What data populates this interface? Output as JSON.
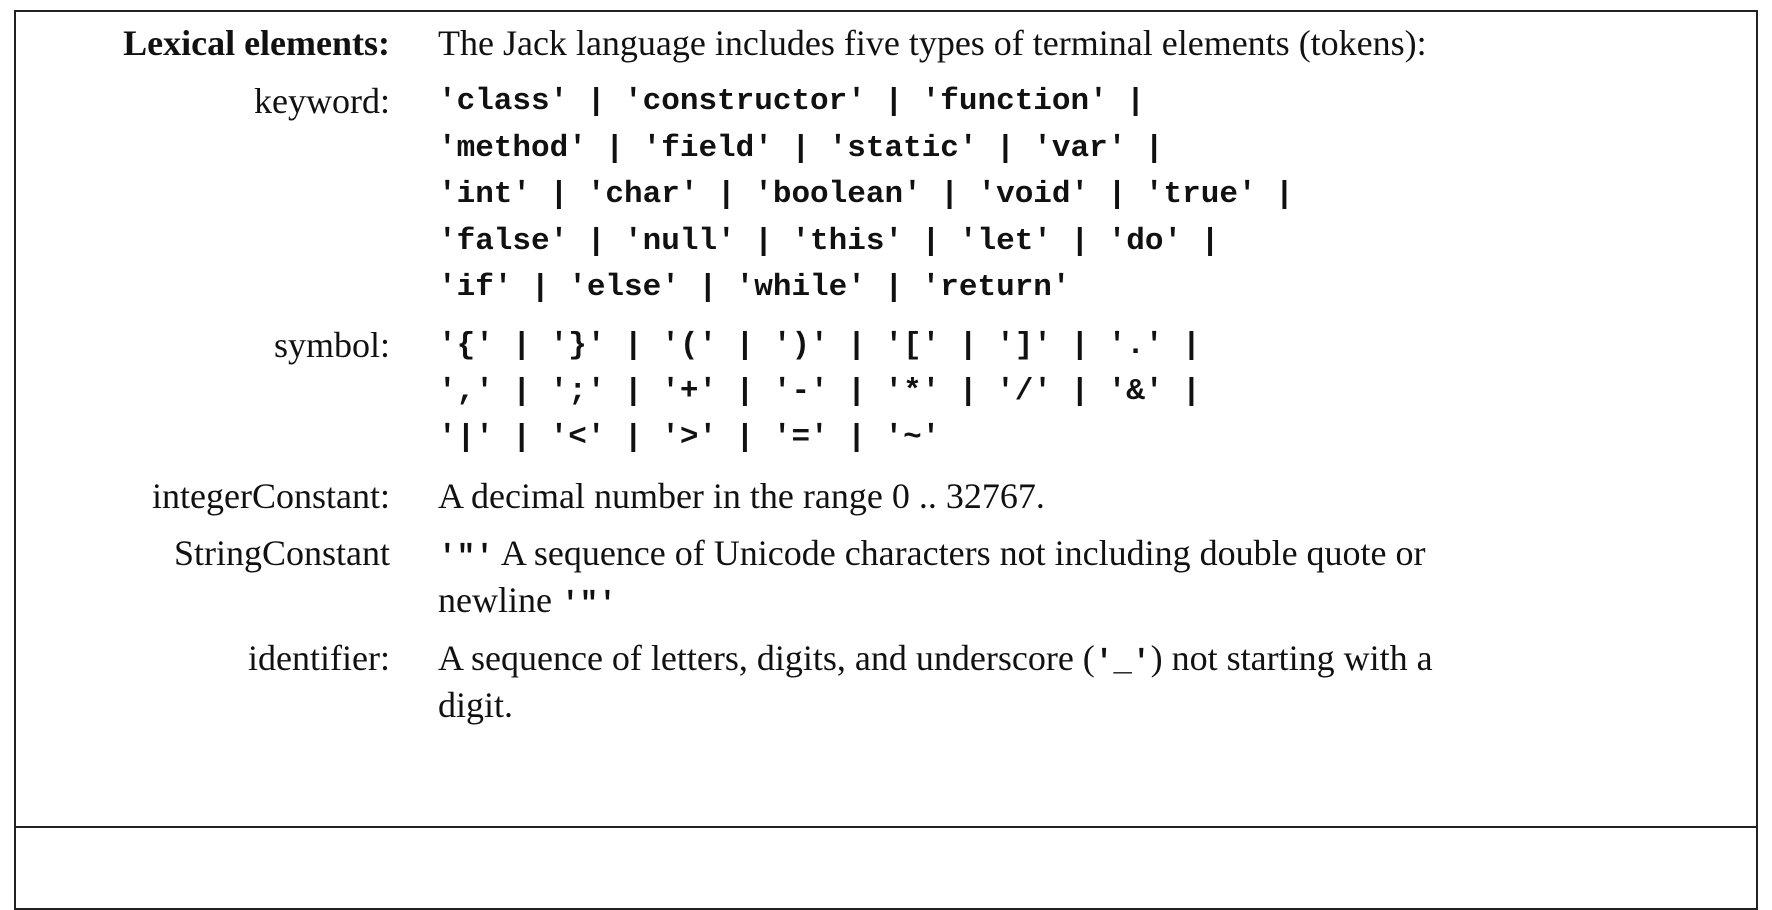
{
  "lexical": {
    "heading_label": "Lexical elements:",
    "heading_text": "The Jack language includes five types of terminal elements (tokens):",
    "keyword": {
      "label": "keyword:",
      "lines": [
        "'class' | 'constructor' | 'function' |",
        "'method' | 'field' | 'static' | 'var' |",
        "'int' | 'char' | 'boolean' | 'void' | 'true' |",
        "'false' | 'null' | 'this' | 'let' | 'do' |",
        "'if' | 'else' | 'while' | 'return'"
      ]
    },
    "symbol": {
      "label": "symbol:",
      "lines": [
        "'{' | '}' | '(' | ')' | '[' | ']' | '.' |",
        "',' | ';' | '+' | '-' | '*' | '/' | '&' |",
        "'|' | '<' | '>' | '=' | '~'"
      ]
    },
    "integer_constant": {
      "label": "integerConstant:",
      "text": "A decimal number in the range 0 .. 32767."
    },
    "string_constant": {
      "label": "StringConstant",
      "quote_open": "'\"'",
      "text_line1": " A sequence of Unicode characters not including double quote or",
      "text_line2": "newline ",
      "quote_close": "'\"'"
    },
    "identifier": {
      "label": "identifier:",
      "text_line1_a": "A sequence of letters, digits, and underscore (",
      "underscore": "'_'",
      "text_line1_b": ") not starting with a",
      "text_line2": "digit."
    }
  }
}
